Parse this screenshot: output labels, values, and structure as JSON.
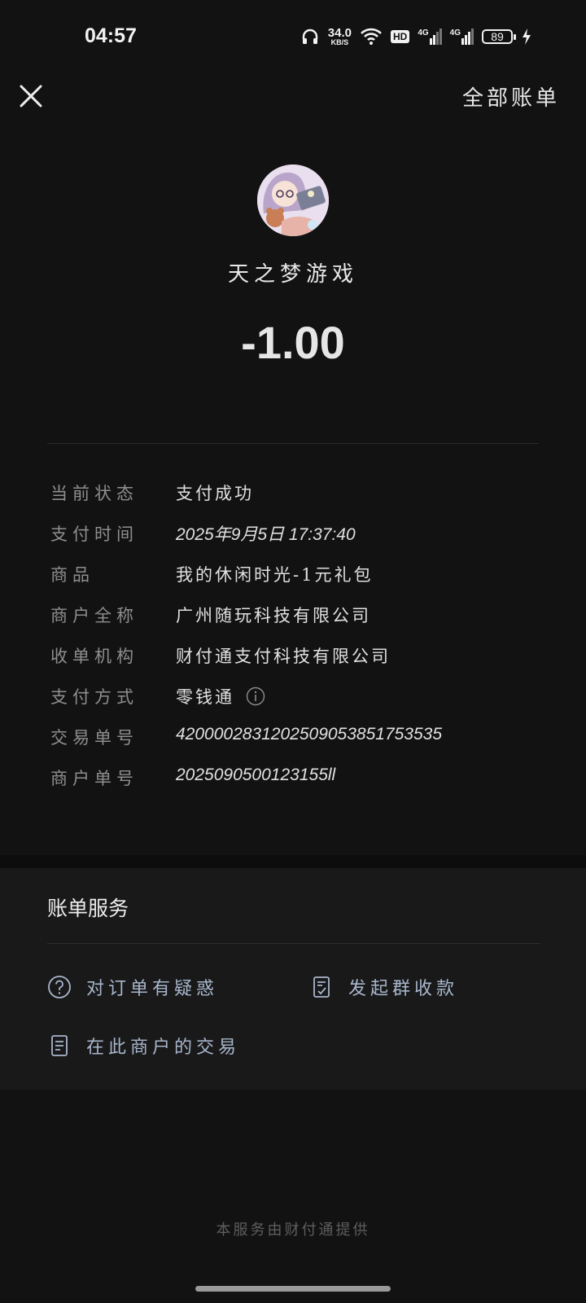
{
  "status_bar": {
    "time": "04:57",
    "net_speed_value": "34.0",
    "net_speed_unit": "KB/S",
    "hd_label": "HD",
    "signal1_label": "4G",
    "signal2_label": "4G",
    "battery_level": "89",
    "icons": [
      "headphones-icon",
      "wifi-icon",
      "hd-icon",
      "signal-icon",
      "signal-icon",
      "battery-icon",
      "charging-icon"
    ]
  },
  "header": {
    "close_icon": "close-icon",
    "all_bills_label": "全部账单"
  },
  "merchant": {
    "name": "天之梦游戏",
    "amount": "-1.00"
  },
  "details": [
    {
      "key": "当前状态",
      "value": "支付成功"
    },
    {
      "key": "支付时间",
      "value": "2025年9月5日 17:37:40"
    },
    {
      "key": "商品",
      "value": "我的休闲时光-1元礼包"
    },
    {
      "key": "商户全称",
      "value": "广州随玩科技有限公司"
    },
    {
      "key": "收单机构",
      "value": "财付通支付科技有限公司"
    },
    {
      "key": "支付方式",
      "value": "零钱通"
    },
    {
      "key": "交易单号",
      "value": "4200002831202509053851753535"
    },
    {
      "key": "商户单号",
      "value": "2025090500123155ll"
    }
  ],
  "services": {
    "title": "账单服务",
    "items": [
      {
        "label": "对订单有疑惑",
        "icon": "question-circle-icon"
      },
      {
        "label": "发起群收款",
        "icon": "checklist-icon"
      },
      {
        "label": "在此商户的交易",
        "icon": "document-icon"
      }
    ]
  },
  "footer": {
    "note": "本服务由财付通提供"
  },
  "colors": {
    "background": "#121212",
    "service_panel": "#191919",
    "service_text": "#a8b6cc",
    "label_gray": "#8e8e8e"
  }
}
